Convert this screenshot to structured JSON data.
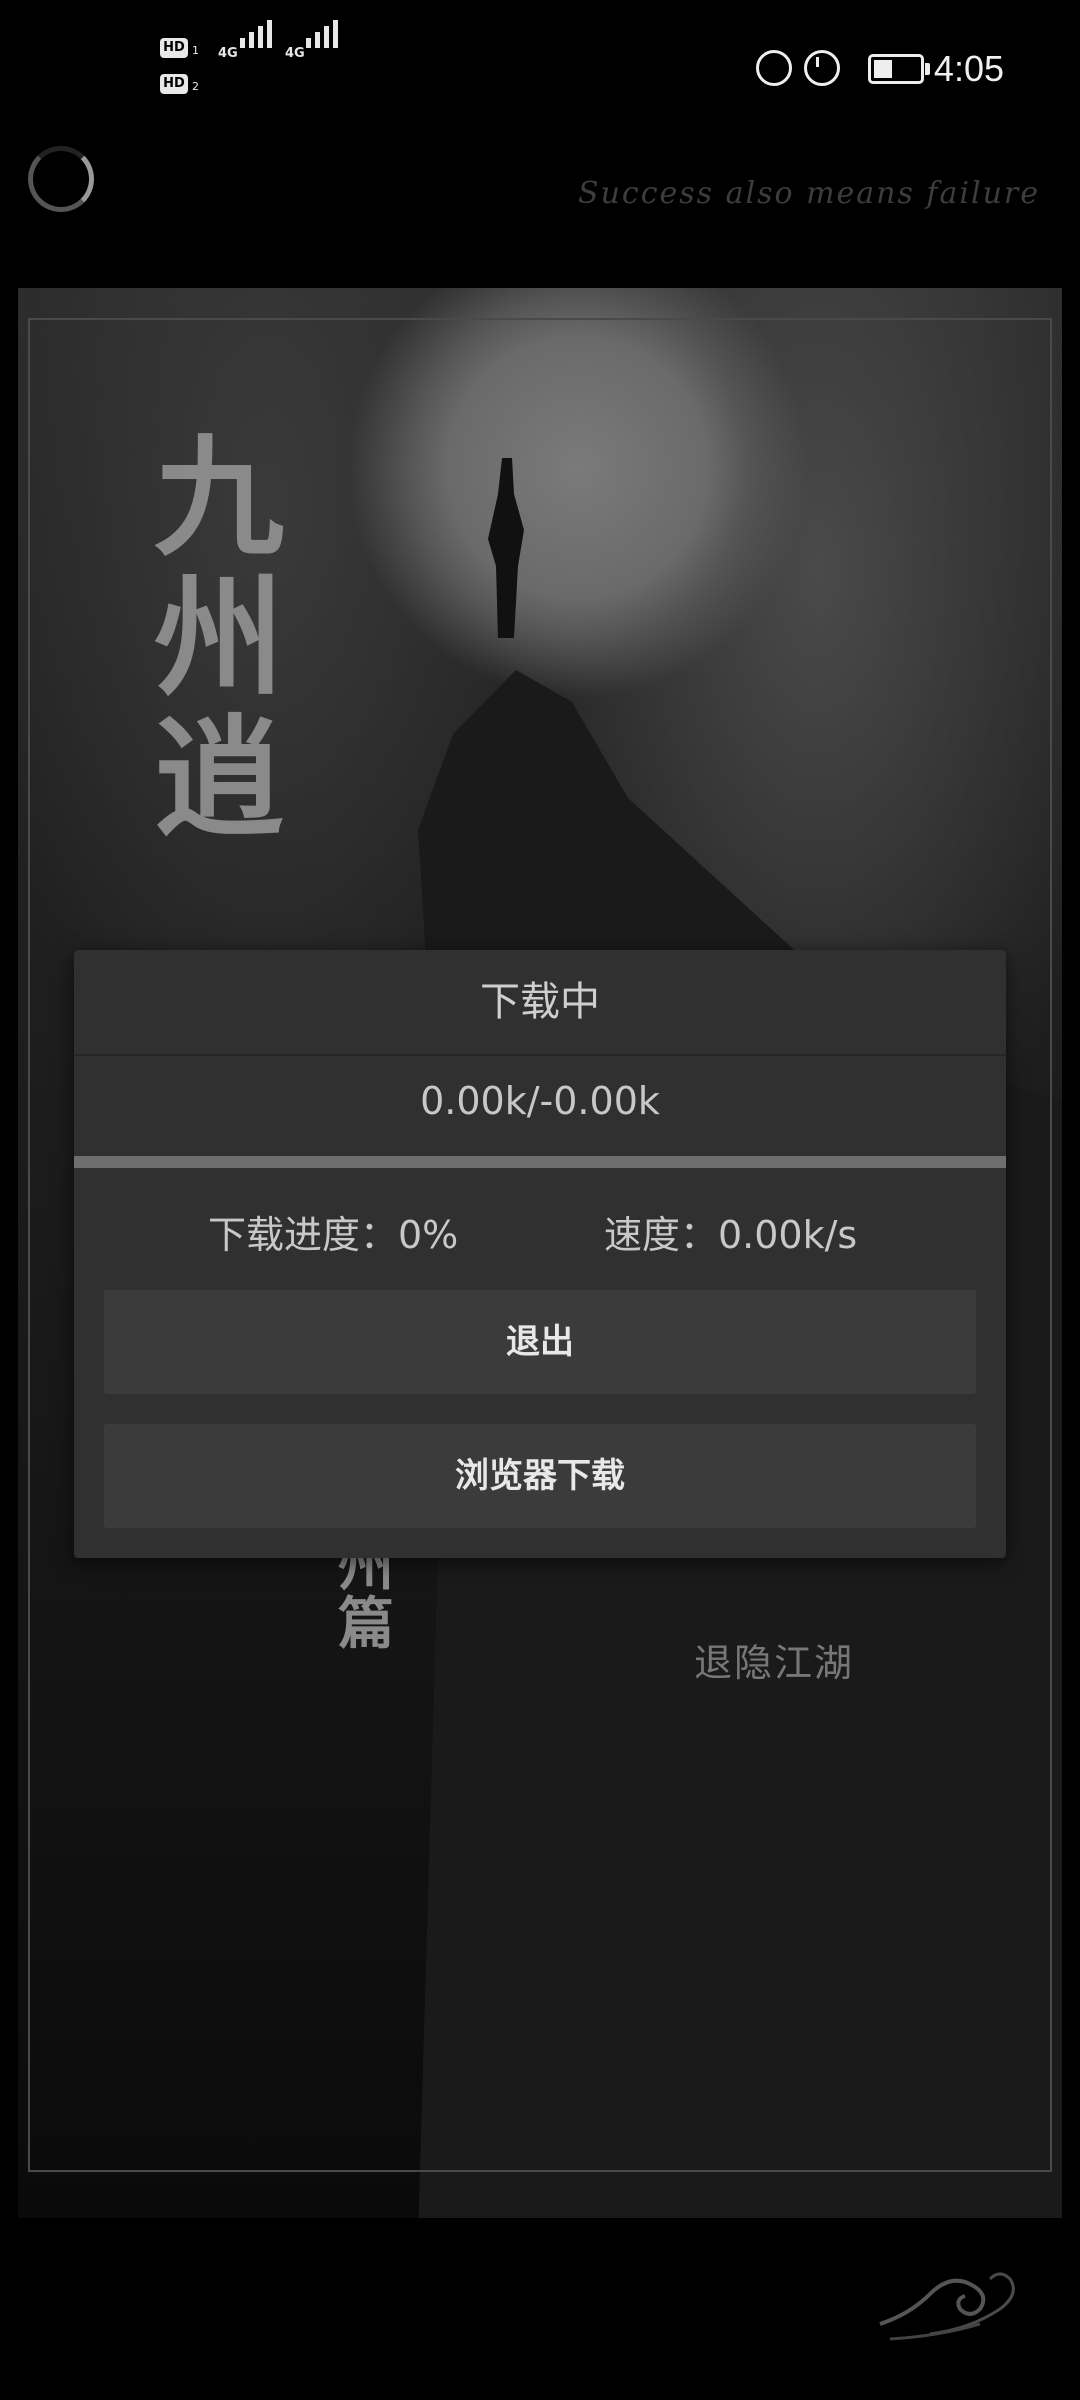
{
  "status_bar": {
    "sim1": "HD",
    "sim1_index": "1",
    "sim2": "HD",
    "sim2_index": "2",
    "network1": "4G",
    "network2": "4G",
    "time": "4:05",
    "battery_level": 0.4,
    "icons": [
      "data-saver-icon",
      "alarm-icon",
      "battery-icon"
    ]
  },
  "header": {
    "motto": "Success also means failure"
  },
  "poster": {
    "title_chars": [
      "九",
      "州",
      "逍"
    ],
    "subtitle_chars": [
      "州",
      "篇"
    ],
    "tagline": "退隐江湖"
  },
  "dialog": {
    "title": "下载中",
    "size_text": "0.00k/-0.00k",
    "progress_fraction": 0,
    "progress_label": "下载进度：0%",
    "speed_label": "速度：0.00k/s",
    "exit_button": "退出",
    "browser_download_button": "浏览器下载"
  }
}
